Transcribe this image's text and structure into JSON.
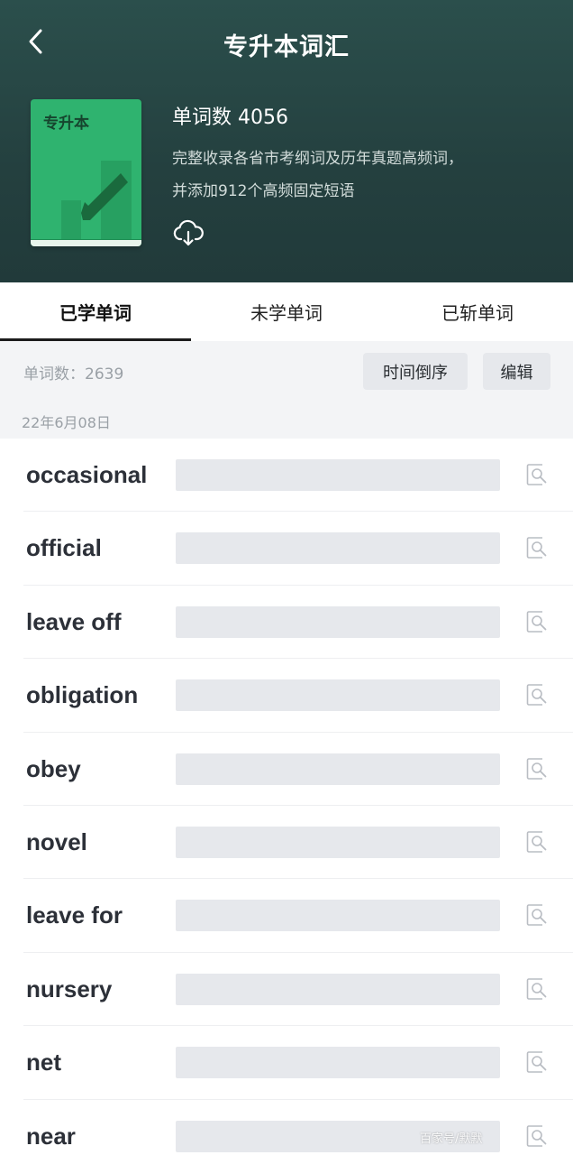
{
  "header": {
    "back_icon": "chevron-left-icon",
    "title": "专升本词汇",
    "book": {
      "cover_label": "专升本",
      "word_count_label": "单词数 4056",
      "description_line1": "完整收录各省市考纲词及历年真题高频词，",
      "description_line2": "并添加912个高频固定短语",
      "download_icon": "cloud-download-icon"
    }
  },
  "tabs": [
    {
      "label": "已学单词",
      "active": true
    },
    {
      "label": "未学单词",
      "active": false
    },
    {
      "label": "已斩单词",
      "active": false
    }
  ],
  "subbar": {
    "count_label": "单词数：2639",
    "sort_button": "时间倒序",
    "edit_button": "编辑",
    "date_label": "22年6月08日"
  },
  "words": [
    "occasional",
    "official",
    "leave off",
    "obligation",
    "obey",
    "novel",
    "leave for",
    "nursery",
    "net",
    "near"
  ],
  "watermark": "百家号/默默",
  "colors": {
    "header_bg": "#24403f",
    "cover_green": "#2fb36f",
    "mask_gray": "#e6e8ec"
  }
}
